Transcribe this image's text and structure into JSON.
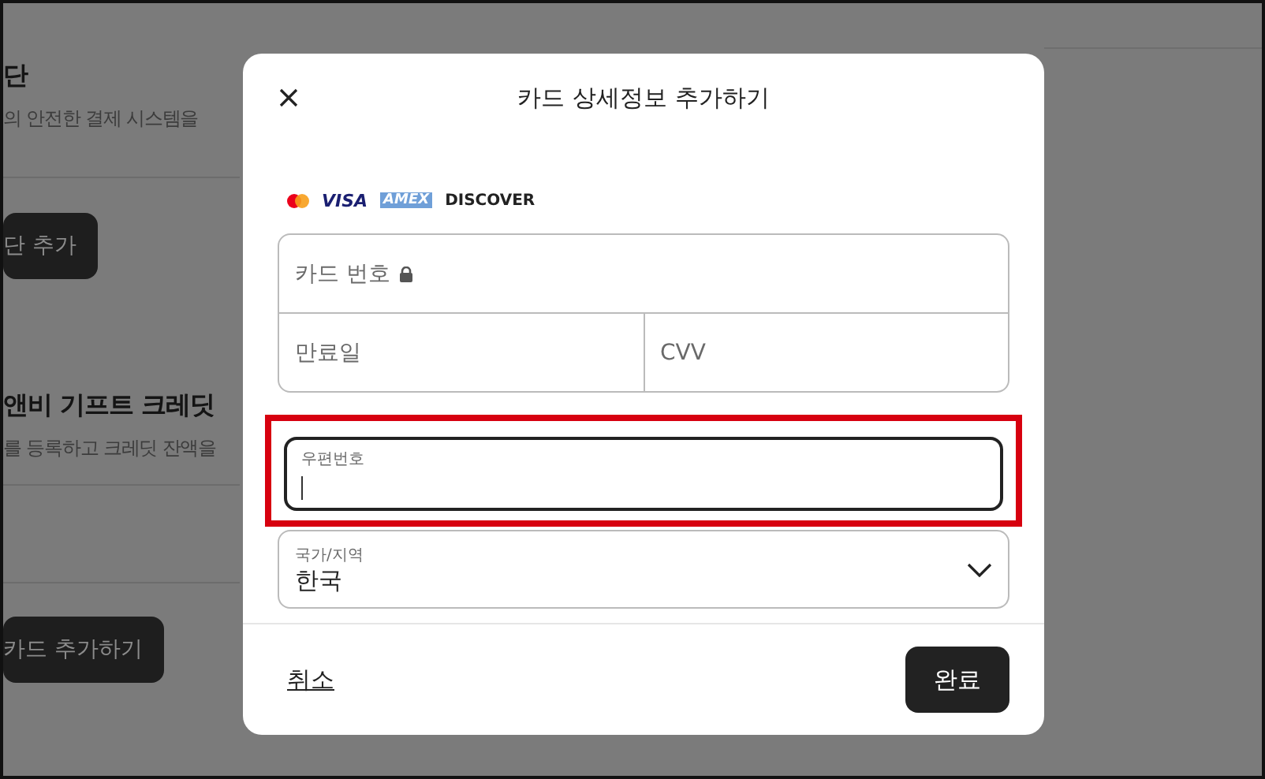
{
  "background": {
    "sections": [
      {
        "title": "단",
        "description": "의 안전한 결제 시스템을",
        "button": "단 추가"
      },
      {
        "title": "앤비 기프트 크레딧",
        "description": "를 등록하고 크레딧 잔액을",
        "button": "카드 추가하기"
      }
    ]
  },
  "dialog": {
    "title": "카드 상세정보 추가하기",
    "card_brands": [
      {
        "kind": "mastercard"
      },
      {
        "kind": "visa",
        "text": "VISA"
      },
      {
        "kind": "amex",
        "text": "AMEX"
      },
      {
        "kind": "discover",
        "text": "DISCOVER"
      }
    ],
    "card_fields": [
      {
        "placeholder": "카드 번호",
        "locked": true
      },
      {
        "placeholder": "만료일",
        "locked": false
      },
      {
        "placeholder": "CVV",
        "locked": false
      }
    ],
    "postal_code": {
      "label": "우편번호",
      "focused": true,
      "highlighted": true
    },
    "country": {
      "label": "국가/지역",
      "value": "한국"
    },
    "cancel": "취소",
    "done": "완료"
  }
}
